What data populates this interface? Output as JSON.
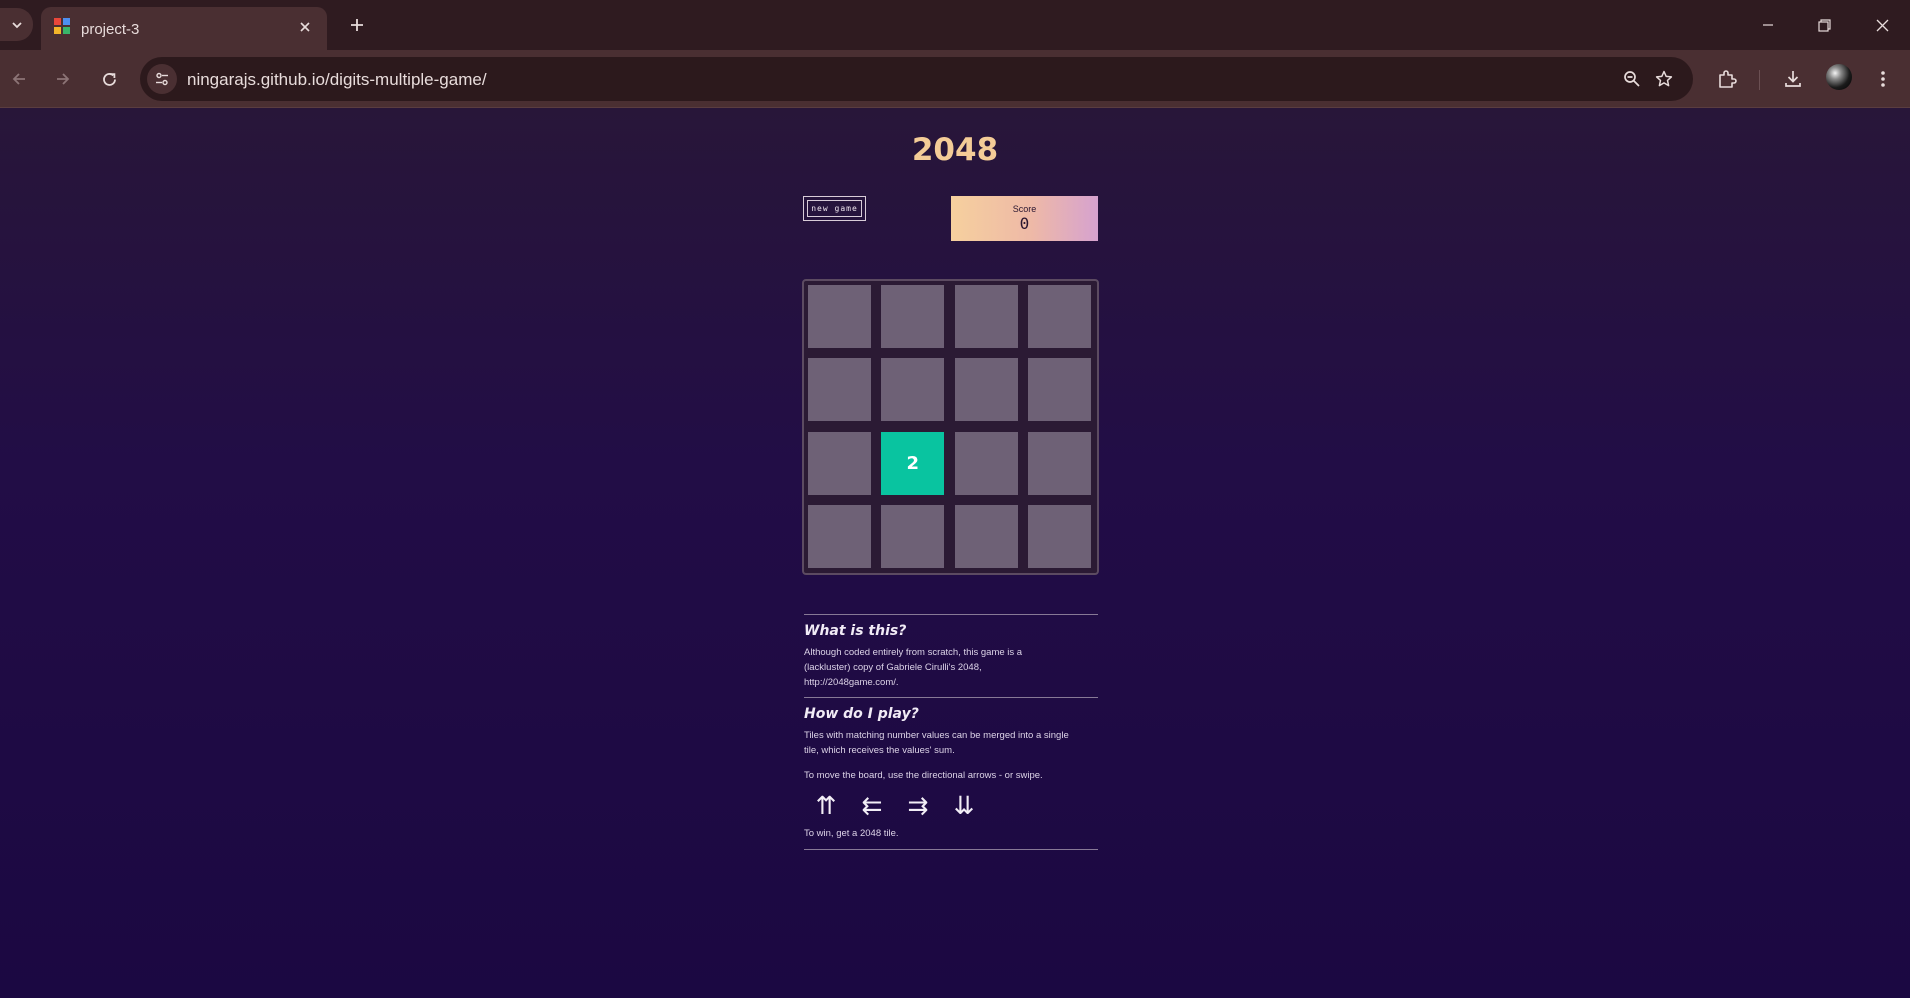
{
  "browser": {
    "tab_title": "project-3",
    "url": "ningarajs.github.io/digits-multiple-game/"
  },
  "game": {
    "title": "2048",
    "new_game_label": "new game",
    "score_label": "Score",
    "score_value": "0",
    "grid": [
      [
        "",
        "",
        "",
        ""
      ],
      [
        "",
        "",
        "",
        ""
      ],
      [
        "",
        "2",
        "",
        ""
      ],
      [
        "",
        "",
        "",
        ""
      ]
    ],
    "tile_color": "#09c4a0"
  },
  "info": {
    "what_heading": "What is this?",
    "what_text_1": "Although coded entirely from scratch, this game is a",
    "what_text_2": "(lackluster) copy of Gabriele Cirulli's 2048,",
    "what_text_3": "http://2048game.com/.",
    "how_heading": "How do I play?",
    "how_text_1": "Tiles with matching number values can be merged into a single",
    "how_text_2": "tile, which receives the values' sum.",
    "move_text": "To move the board, use the directional arrows - or swipe.",
    "arrows": [
      "⇈",
      "⇇",
      "⇉",
      "⇊"
    ],
    "win_text": "To win, get a 2048 tile."
  }
}
